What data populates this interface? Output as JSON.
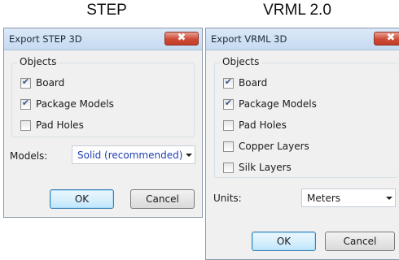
{
  "headings": {
    "step": "STEP",
    "vrml": "VRML 2.0"
  },
  "step_dialog": {
    "title": "Export STEP 3D",
    "close_glyph": "✖",
    "objects_group": {
      "legend": "Objects",
      "items": [
        {
          "label": "Board",
          "checked": true
        },
        {
          "label": "Package Models",
          "checked": true
        },
        {
          "label": "Pad Holes",
          "checked": false
        }
      ]
    },
    "models_label": "Models:",
    "models_value": "Solid (recommended)",
    "ok_label": "OK",
    "cancel_label": "Cancel"
  },
  "vrml_dialog": {
    "title": "Export VRML 3D",
    "close_glyph": "✖",
    "objects_group": {
      "legend": "Objects",
      "items": [
        {
          "label": "Board",
          "checked": true
        },
        {
          "label": "Package Models",
          "checked": true
        },
        {
          "label": "Pad Holes",
          "checked": false
        },
        {
          "label": "Copper Layers",
          "checked": false
        },
        {
          "label": "Silk Layers",
          "checked": false
        }
      ]
    },
    "units_label": "Units:",
    "units_value": "Meters",
    "ok_label": "OK",
    "cancel_label": "Cancel"
  },
  "colors": {
    "dialog_bg": "#f0f0f0",
    "titlebar": "#c6daf0",
    "close_button": "#cd4a35",
    "select_text_blue": "#1f3fb0",
    "check_mark": "#3b5a8a"
  }
}
